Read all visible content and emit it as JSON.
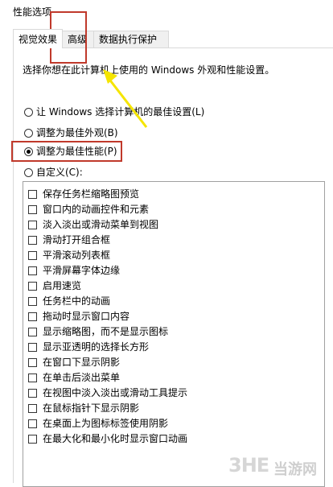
{
  "window": {
    "title": "性能选项"
  },
  "tabs": [
    {
      "label": "视觉效果",
      "active": true
    },
    {
      "label": "高级",
      "active": false
    },
    {
      "label": "数据执行保护",
      "active": false
    }
  ],
  "description": "选择你想在此计算机上使用的 Windows 外观和性能设置。",
  "options": [
    {
      "label": "让 Windows 选择计算机的最佳设置(L)",
      "selected": false
    },
    {
      "label": "调整为最佳外观(B)",
      "selected": false
    },
    {
      "label": "调整为最佳性能(P)",
      "selected": true
    },
    {
      "label": "自定义(C):",
      "selected": false
    }
  ],
  "effects": [
    {
      "label": "保存任务栏缩略图预览",
      "checked": false
    },
    {
      "label": "窗口内的动画控件和元素",
      "checked": false
    },
    {
      "label": "淡入淡出或滑动菜单到视图",
      "checked": false
    },
    {
      "label": "滑动打开组合框",
      "checked": false
    },
    {
      "label": "平滑滚动列表框",
      "checked": false
    },
    {
      "label": "平滑屏幕字体边缘",
      "checked": false
    },
    {
      "label": "启用速览",
      "checked": false
    },
    {
      "label": "任务栏中的动画",
      "checked": false
    },
    {
      "label": "拖动时显示窗口内容",
      "checked": false
    },
    {
      "label": "显示缩略图，而不是显示图标",
      "checked": false
    },
    {
      "label": "显示亚透明的选择长方形",
      "checked": false
    },
    {
      "label": "在窗口下显示阴影",
      "checked": false
    },
    {
      "label": "在单击后淡出菜单",
      "checked": false
    },
    {
      "label": "在视图中淡入淡出或滑动工具提示",
      "checked": false
    },
    {
      "label": "在鼠标指针下显示阴影",
      "checked": false
    },
    {
      "label": "在桌面上为图标标签使用阴影",
      "checked": false
    },
    {
      "label": "在最大化和最小化时显示窗口动画",
      "checked": false
    }
  ],
  "watermark": {
    "logo": "3HE",
    "site": "当游网"
  },
  "colors": {
    "highlight_box": "#c0392b",
    "arrow": "#f5e500"
  }
}
